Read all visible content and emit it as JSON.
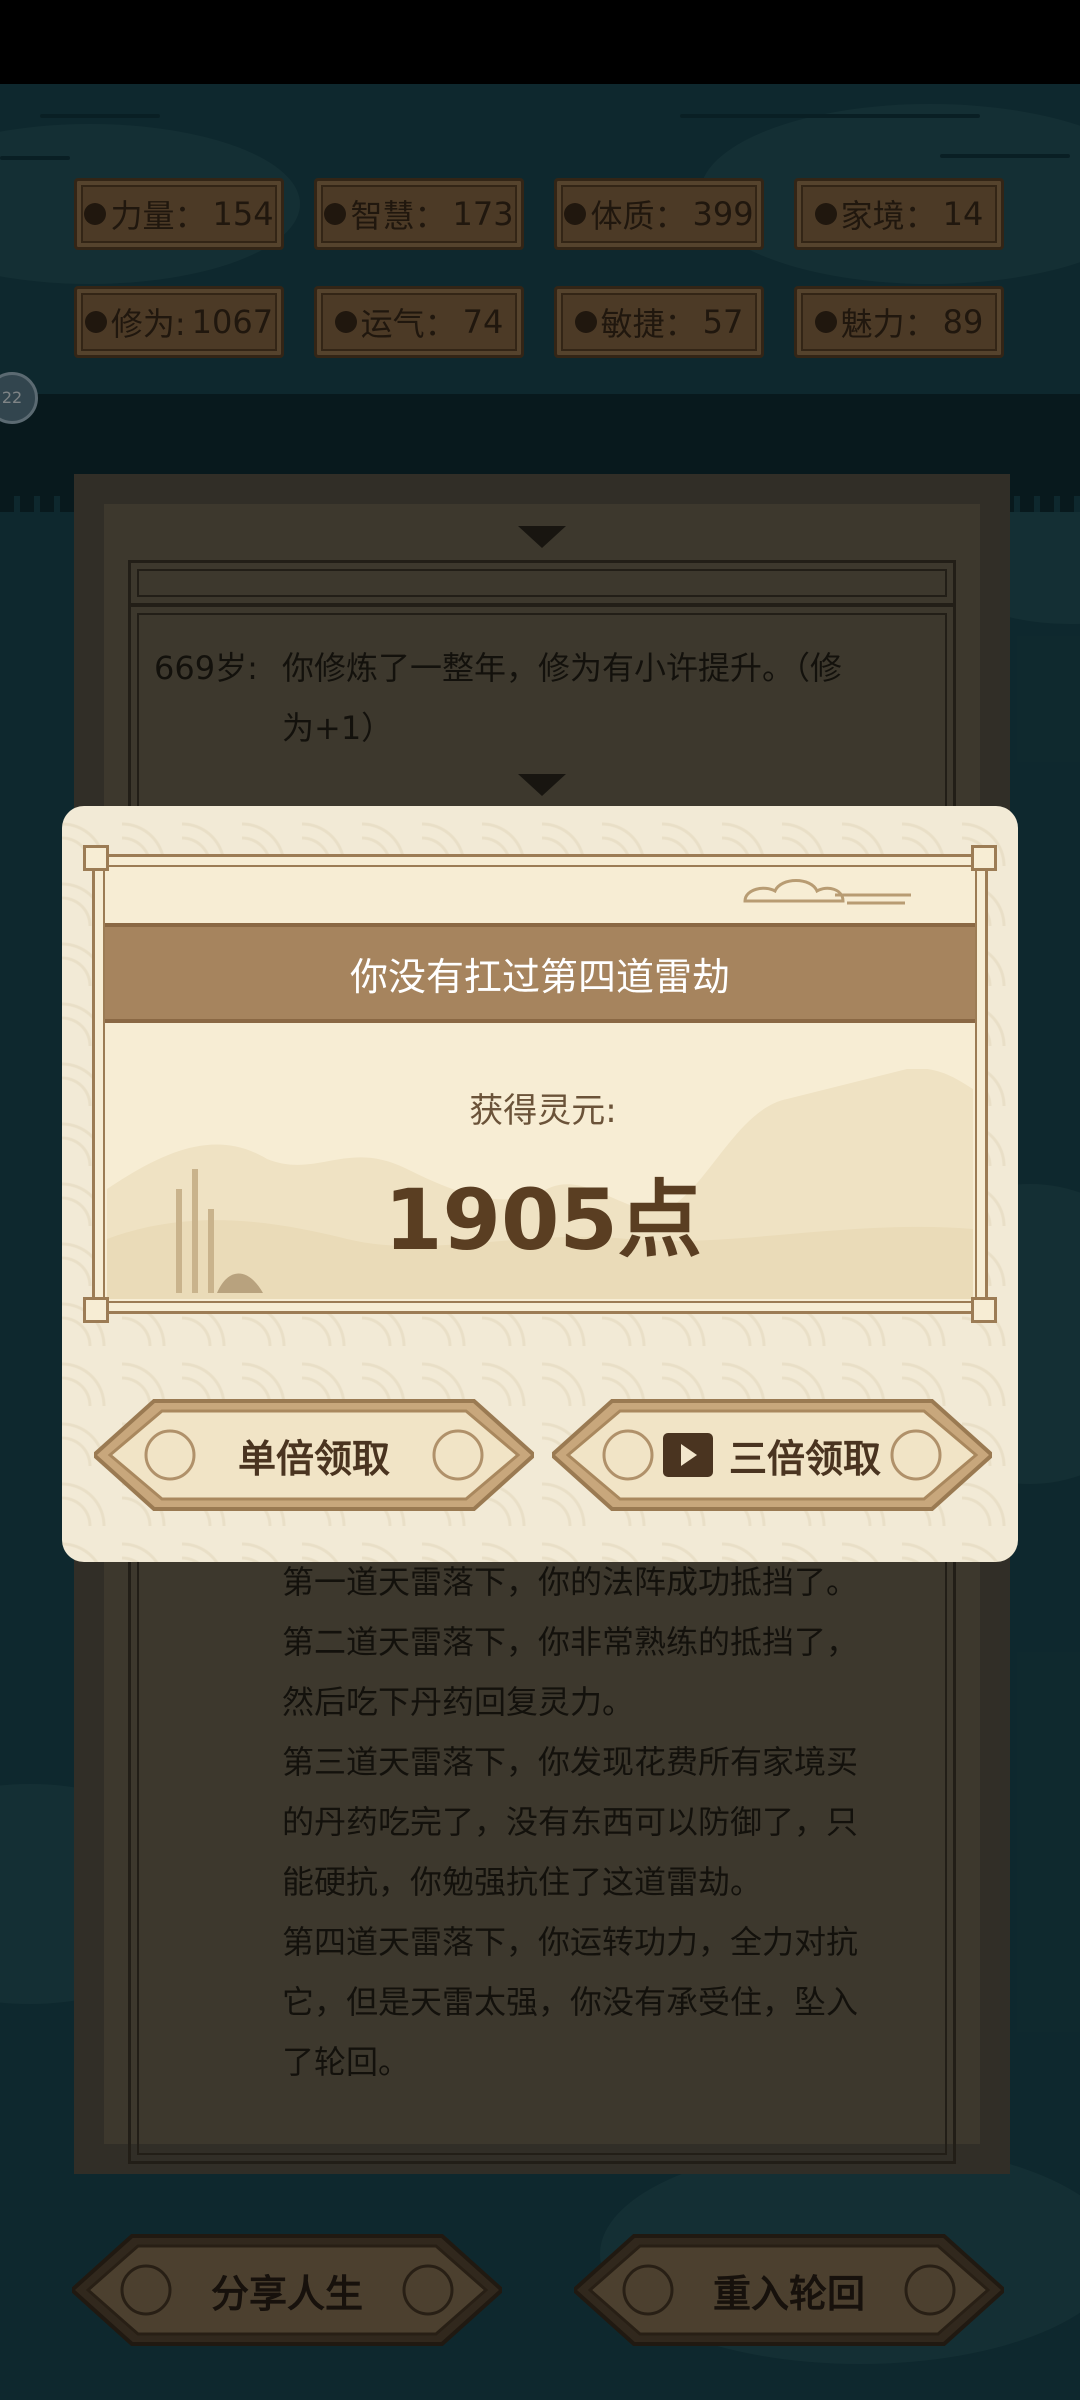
{
  "stats_row1": [
    {
      "label": "力量：",
      "value": "154",
      "icon": "muscle-icon"
    },
    {
      "label": "智慧：",
      "value": "173",
      "icon": "bulb-icon"
    },
    {
      "label": "体质：",
      "value": "399",
      "icon": "flower-icon"
    },
    {
      "label": "家境：",
      "value": "14",
      "icon": "house-icon"
    }
  ],
  "stats_row2": [
    {
      "label": "修为:",
      "value": "1067",
      "icon": "cloud-icon"
    },
    {
      "label": "运气：",
      "value": "74",
      "icon": "luck-icon"
    },
    {
      "label": "敏捷：",
      "value": "57",
      "icon": "lightning-icon"
    },
    {
      "label": "魅力：",
      "value": "89",
      "icon": "heart-icon"
    }
  ],
  "age_chip": "22",
  "log": {
    "age": "669岁:",
    "entry_line1": "你修炼了一整年，修为有小许提升。（修",
    "entry_line2": "为+1）",
    "thunder_lines": [
      "第一道天雷落下，你的法阵成功抵挡了。",
      "第二道天雷落下，你非常熟练的抵挡了，",
      "然后吃下丹药回复灵力。",
      "第三道天雷落下，你发现花费所有家境买",
      "的丹药吃完了，没有东西可以防御了，只",
      "能硬抗，你勉强抗住了这道雷劫。",
      "第四道天雷落下，你运转功力，全力对抗",
      "它，但是天雷太强，你没有承受住，坠入",
      "了轮回。"
    ]
  },
  "modal": {
    "title": "你没有扛过第四道雷劫",
    "reward_label": "获得灵元:",
    "reward_value": "1905点",
    "single_button": "单倍领取",
    "triple_button": "三倍领取",
    "triple_icon": "play-icon"
  },
  "bottom": {
    "share_button": "分享人生",
    "restart_button": "重入轮回"
  }
}
